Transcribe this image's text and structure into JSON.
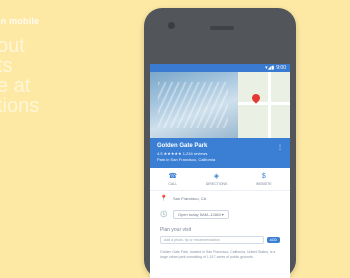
{
  "promo": {
    "overline": "on mobile",
    "heading_lines": [
      "out",
      "ts",
      "e at",
      "tions"
    ]
  },
  "phone": {
    "status": {
      "icons": "▾◢▮",
      "time": "9:00"
    },
    "place": {
      "title": "Golden Gate Park",
      "meta": "4.5 ★★★★★ 1,234 reviews",
      "sub": "Park in San Francisco, California"
    },
    "actions": [
      {
        "icon": "☎",
        "label": "CALL"
      },
      {
        "icon": "◈",
        "label": "DIRECTIONS"
      },
      {
        "icon": "$",
        "label": "WEBSITE"
      }
    ],
    "address_icon": "📍",
    "address": "San Francisco, CA",
    "hours_icon": "🕓",
    "hours": "Open today  5AM–12AM ▾",
    "suggest_title": "Plan your visit",
    "suggest_placeholder": "Add a photo, tip or recommendation",
    "suggest_badge": "ADD",
    "description": "Golden Gate Park, located in San Francisco, California, United States, is a large urban park consisting of 1,017 acres of public grounds."
  },
  "colors": {
    "background": "#fde9a4",
    "accent": "#3b7fd4",
    "phone_body": "#52565a"
  }
}
